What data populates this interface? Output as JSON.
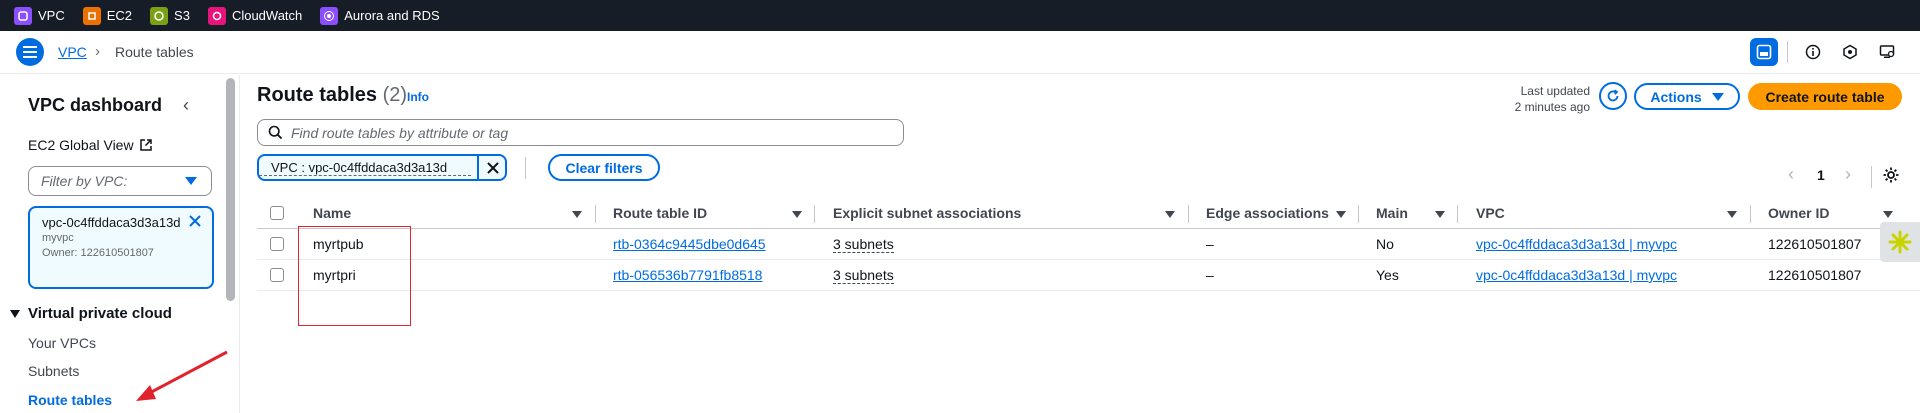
{
  "services": [
    {
      "label": "VPC",
      "color": "#8c4fff"
    },
    {
      "label": "EC2",
      "color": "#ed7100"
    },
    {
      "label": "S3",
      "color": "#7aa116"
    },
    {
      "label": "CloudWatch",
      "color": "#e7157b"
    },
    {
      "label": "Aurora and RDS",
      "color": "#8c4fff"
    }
  ],
  "breadcrumb": {
    "parent": "VPC",
    "current": "Route tables"
  },
  "sidebar": {
    "title": "VPC dashboard",
    "global_view": "EC2 Global View",
    "filter_placeholder": "Filter by VPC:",
    "token": {
      "id": "vpc-0c4ffddaca3d3a13d",
      "name": "myvpc",
      "owner": "Owner: 122610501807"
    },
    "section": "Virtual private cloud",
    "items": [
      "Your VPCs",
      "Subnets",
      "Route tables"
    ]
  },
  "main": {
    "title": "Route tables",
    "count": "(2)",
    "info": "Info",
    "last_updated_label": "Last updated",
    "last_updated_value": "2 minutes ago",
    "actions_label": "Actions",
    "create_label": "Create route table",
    "search_placeholder": "Find route tables by attribute or tag",
    "filter_token": "VPC : vpc-0c4ffddaca3d3a13d",
    "clear_filters": "Clear filters",
    "page": "1"
  },
  "table": {
    "columns": [
      "Name",
      "Route table ID",
      "Explicit subnet associations",
      "Edge associations",
      "Main",
      "VPC",
      "Owner ID"
    ],
    "rows": [
      {
        "name": "myrtpub",
        "id": "rtb-0364c9445dbe0d645",
        "subnets": "3 subnets",
        "edge": "–",
        "main": "No",
        "vpc": "vpc-0c4ffddaca3d3a13d | myvpc",
        "owner": "122610501807"
      },
      {
        "name": "myrtpri",
        "id": "rtb-056536b7791fb8518",
        "subnets": "3 subnets",
        "edge": "–",
        "main": "Yes",
        "vpc": "vpc-0c4ffddaca3d3a13d | myvpc",
        "owner": "122610501807"
      }
    ]
  },
  "colors": {
    "accent": "#006ce0",
    "primary_button": "#ff9900",
    "annotation": "#e0232c"
  }
}
